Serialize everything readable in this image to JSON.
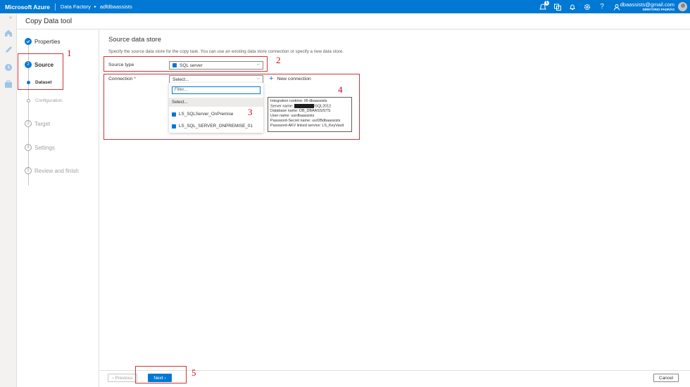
{
  "topbar": {
    "brand": "Microsoft Azure",
    "breadcrumb_service": "Data Factory",
    "breadcrumb_arrow": "▸",
    "breadcrumb_factory": "adfdbaassists",
    "notification_count": "1",
    "user_email": "dbaassists@gmail.com",
    "user_directory": "DIRETÓRIO PADRÃO",
    "icons": [
      "notifications-icon",
      "directory-switch-icon",
      "bell-icon",
      "settings-icon",
      "help-icon",
      "feedback-icon"
    ]
  },
  "header": {
    "title": "Copy Data tool"
  },
  "steps": [
    {
      "num": "",
      "label": "Properties"
    },
    {
      "num": "2",
      "label": "Source"
    },
    {
      "num": "",
      "label": "Dataset"
    },
    {
      "num": "",
      "label": "Configuration"
    },
    {
      "num": "3",
      "label": "Target"
    },
    {
      "num": "4",
      "label": "Settings"
    },
    {
      "num": "5",
      "label": "Review and finish"
    }
  ],
  "main": {
    "title": "Source data store",
    "description": "Specify the source data store for the copy task. You can use an existing data store connection or specify a new data store.",
    "source_type_label": "Source type",
    "source_type_value": "SQL server",
    "connection_label": "Connection",
    "connection_required": "*",
    "connection_value": "Select...",
    "new_connection": "New connection",
    "dropdown": {
      "filter_placeholder": "Filter...",
      "items": [
        "Select...",
        "LS_SQLServer_OnPremise",
        "LS_SQL_SERVER_ONPREMISE_01"
      ]
    },
    "tooltip": {
      "line1": "Integration runtime: IR-dbaassists",
      "line2_prefix": "Server name:",
      "line2_suffix": "\\SQL2012",
      "line3": "Database name: DB_DBAASSISTS",
      "line4": "User name: usrdbaassists",
      "line5": "Password-Secret name: usrDBdbaassists",
      "line6": "Password-AKV linked service: LS_KeyVault"
    }
  },
  "footer": {
    "previous": "‹ Previous",
    "next": "Next ›",
    "cancel": "Cancel"
  },
  "callouts": [
    "1",
    "2",
    "3",
    "4",
    "5"
  ],
  "colors": {
    "accent": "#0078d4",
    "callout": "#d13438"
  }
}
